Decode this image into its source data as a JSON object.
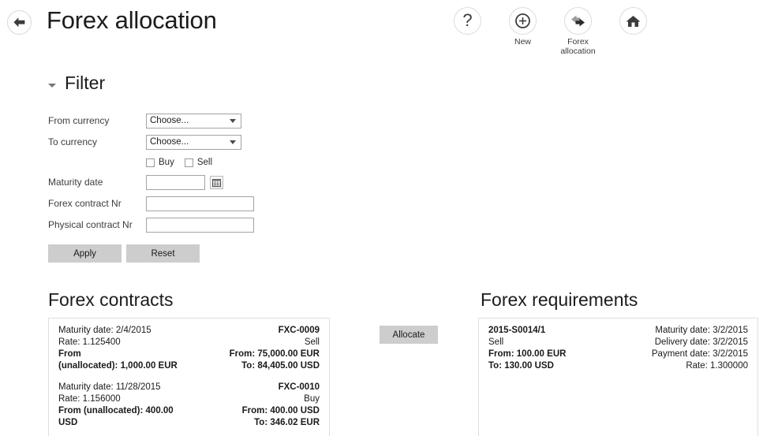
{
  "header": {
    "back_icon": "arrow-left-circle-icon",
    "title": "Forex allocation",
    "tools": [
      {
        "icon": "question-mark-icon",
        "label": ""
      },
      {
        "icon": "circle-plus-icon",
        "label": "New"
      },
      {
        "icon": "left-right-arrows-icon",
        "label": "Forex\nallocation"
      },
      {
        "icon": "home-icon",
        "label": ""
      }
    ],
    "tool_labels": {
      "help": "",
      "new": "New",
      "forex_allocation_line1": "Forex",
      "forex_allocation_line2": "allocation",
      "home": ""
    }
  },
  "filter": {
    "toggle_icon": "triangle-down-icon",
    "title": "Filter",
    "fields": {
      "from_currency_label": "From currency",
      "from_currency_value": "Choose...",
      "to_currency_label": "To currency",
      "to_currency_value": "Choose...",
      "buy_label": "Buy",
      "buy_checked": false,
      "sell_label": "Sell",
      "sell_checked": false,
      "maturity_date_label": "Maturity date",
      "maturity_date_value": "",
      "calendar_icon": "calendar-icon",
      "forex_contract_nr_label": "Forex contract Nr",
      "forex_contract_nr_value": "",
      "physical_contract_nr_label": "Physical contract Nr",
      "physical_contract_nr_value": ""
    },
    "apply_label": "Apply",
    "reset_label": "Reset"
  },
  "contracts": {
    "title": "Forex contracts",
    "rows": [
      {
        "maturity": "Maturity date: 2/4/2015",
        "rate": "Rate: 1.125400",
        "from_label_line1": "From",
        "from_label_line2": "(unallocated): 1,000.00 EUR",
        "number": "FXC-0009",
        "direction": "Sell",
        "from_amount": "From: 75,000.00 EUR",
        "to_amount": "To: 84,405.00 USD"
      },
      {
        "maturity": "Maturity date: 11/28/2015",
        "rate": "Rate: 1.156000",
        "from_label_line1": "From (unallocated): 400.00 USD",
        "from_label_line2": "",
        "number": "FXC-0010",
        "direction": "Buy",
        "from_amount": "From: 400.00 USD",
        "to_amount": "To: 346.02 EUR"
      }
    ]
  },
  "allocate": {
    "label": "Allocate"
  },
  "requirements": {
    "title": "Forex requirements",
    "rows": [
      {
        "number": "2015-S0014/1",
        "direction": "Sell",
        "from_amount": "From: 100.00 EUR",
        "to_amount": "To: 130.00 USD",
        "maturity": "Maturity date: 3/2/2015",
        "delivery": "Delivery date: 3/2/2015",
        "payment": "Payment date: 3/2/2015",
        "rate": "Rate: 1.300000"
      }
    ]
  },
  "colors": {
    "button_gray": "#cdcdcd",
    "panel_border": "#dedede",
    "input_border": "#a3a3a3",
    "text": "#1a1a1a",
    "label_text": "#3d3d3d"
  }
}
